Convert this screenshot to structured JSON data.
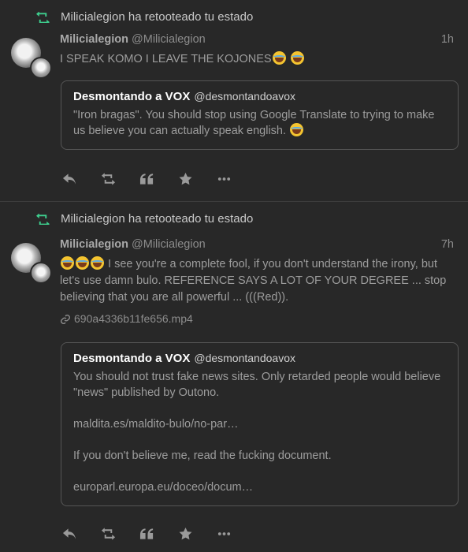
{
  "statuses": [
    {
      "reblog_text": "Milicialegion ha retooteado tu estado",
      "display_name": "Milicialegion",
      "username": "@Milicialegion",
      "time": "1h",
      "content_before_emoji": "I SPEAK KOMO I LEAVE THE KOJONES",
      "quote": {
        "display_name": "Desmontando a VOX",
        "username": "@desmontandoavox",
        "text": "\"Iron bragas\". You should stop using Google Translate to trying to make us believe you can actually speak english."
      }
    },
    {
      "reblog_text": "Milicialegion ha retooteado tu estado",
      "display_name": "Milicialegion",
      "username": "@Milicialegion",
      "time": "7h",
      "content_after_emoji": " I see you're a complete fool, if you don't understand the irony, but let's use damn bulo. REFERENCE SAYS A LOT OF YOUR DEGREE ... stop believing that you are all powerful ... (((Red)).",
      "attachment": "690a4336b11fe656.mp4",
      "quote": {
        "display_name": "Desmontando a VOX",
        "username": "@desmontandoavox",
        "paragraphs": [
          "You should not trust fake news sites. Only retarded people would believe \"news\" published by Outono.",
          "maldita.es/maldito-bulo/no-par…",
          "If you don't believe me, read the fucking document.",
          "europarl.europa.eu/doceo/docum…"
        ]
      }
    }
  ],
  "icons": {
    "reblog": "reblog-icon",
    "reply": "reply-icon",
    "boost": "boost-icon",
    "quote": "quote-icon",
    "favourite": "star-icon",
    "more": "more-icon",
    "link": "link-icon"
  },
  "colors": {
    "background": "#282828",
    "reblog_accent": "#3ecf8e",
    "text": "#9d9d9d",
    "name": "#a8a8a8",
    "quote_name": "#ffffff"
  }
}
